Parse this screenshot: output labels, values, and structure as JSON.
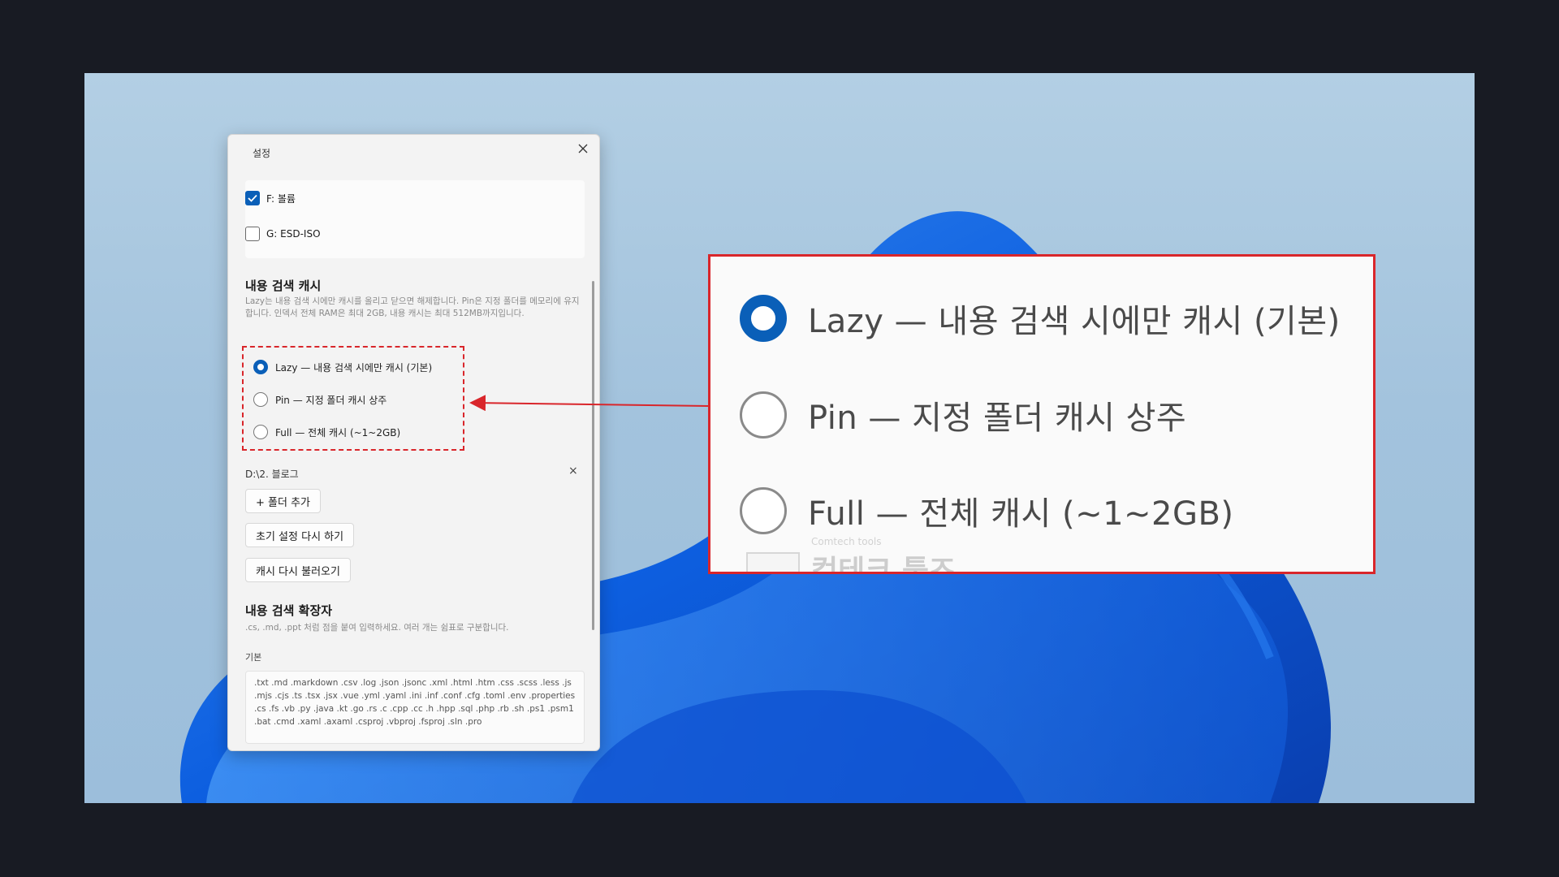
{
  "settings": {
    "title": "설정",
    "drives": [
      {
        "label": "F: 볼륨",
        "checked": true
      },
      {
        "label": "G: ESD-ISO",
        "checked": false
      }
    ],
    "cache_section": {
      "title": "내용 검색 캐시",
      "description": "Lazy는 내용 검색 시에만 캐시를 올리고 닫으면 해제합니다. Pin은 지정 폴더를 메모리에 유지합니다. 인덱서 전체 RAM은 최대 2GB, 내용 캐시는 최대 512MB까지입니다.",
      "options": [
        {
          "label": "Lazy — 내용 검색 시에만 캐시 (기본)",
          "selected": true
        },
        {
          "label": "Pin — 지정 폴더 캐시 상주",
          "selected": false
        },
        {
          "label": "Full — 전체 캐시 (~1~2GB)",
          "selected": false
        }
      ]
    },
    "folder_path": "D:\\2. 블로그",
    "buttons": {
      "add_folder": "+ 폴더 추가",
      "reset_setup": "초기 설정 다시 하기",
      "reload_cache": "캐시 다시 불러오기"
    },
    "extensions_section": {
      "title": "내용 검색 확장자",
      "description": ".cs, .md, .ppt 처럼 점을 붙여 입력하세요. 여러 개는 쉼표로 구분합니다.",
      "default_label": "기본",
      "default_value": ".txt .md .markdown .csv .log .json .jsonc .xml .html .htm .css .scss .less .js .mjs .cjs .ts .tsx .jsx .vue .yml .yaml .ini .inf .conf .cfg .toml .env .properties .cs .fs .vb .py .java .kt .go .rs .c .cpp .cc .h .hpp .sql .php .rb .sh .ps1 .psm1 .bat .cmd .xaml .axaml .csproj .vbproj .fsproj .sln .pro"
    }
  },
  "zoom": {
    "options": [
      {
        "label": "Lazy — 내용 검색 시에만 캐시 (기본)",
        "selected": true
      },
      {
        "label": "Pin — 지정 폴더 캐시 상주",
        "selected": false
      },
      {
        "label": "Full — 전체 캐시 (~1~2GB)",
        "selected": false
      }
    ],
    "watermark_small": "Comtech tools",
    "watermark_big": "컴테크 툴즈"
  },
  "colors": {
    "accent": "#0a5fb8",
    "highlight": "#d9262b",
    "frame": "#181b23"
  },
  "icons": {
    "close": "close-icon",
    "check": "checkmark-icon",
    "remove": "close-x-icon"
  }
}
